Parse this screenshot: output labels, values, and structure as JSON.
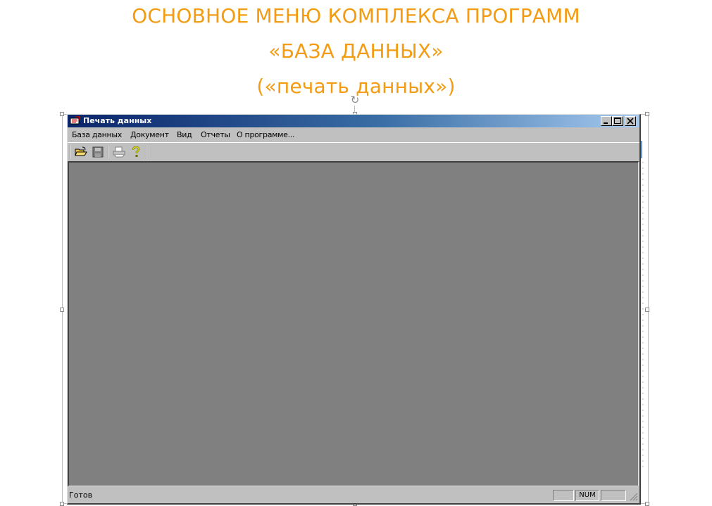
{
  "slide": {
    "line1": "ОСНОВНОЕ МЕНЮ КОМПЛЕКСА ПРОГРАММ",
    "line2": "«БАЗА ДАННЫХ»",
    "line3": "(«печать данных»)",
    "title_color": "#f39c12"
  },
  "window": {
    "title": "Печать данных",
    "titlebar_color": "#0a246a",
    "client_color": "#808080",
    "controls": [
      "minimize-icon",
      "maximize-icon",
      "close-icon"
    ]
  },
  "menubar": {
    "items": [
      "База данных",
      "Документ",
      "Вид",
      "Отчеты",
      "О программе..."
    ]
  },
  "toolbar": {
    "buttons": [
      "open-folder-icon",
      "save-disk-icon",
      "print-icon",
      "help-question-icon"
    ]
  },
  "statusbar": {
    "text": "Готов",
    "panes": [
      "",
      "NUM",
      ""
    ]
  }
}
